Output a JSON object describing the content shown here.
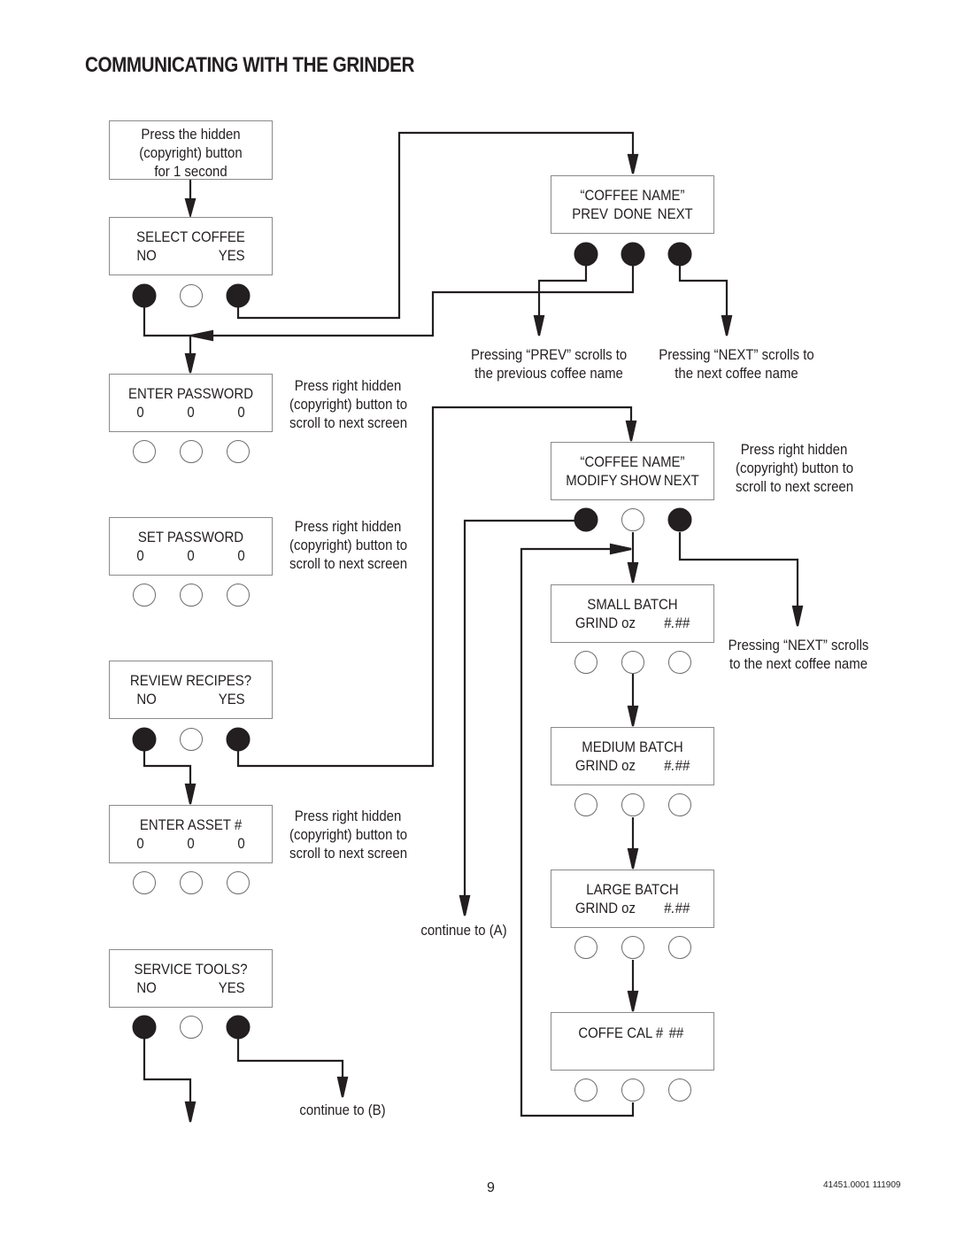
{
  "page": {
    "title": "COMMUNICATING WITH THE GRINDER",
    "page_number": "9",
    "doc_id": "41451.0001 111909"
  },
  "colors": {
    "line": "#231f20",
    "box_border": "#8a8a8a",
    "filled_button": "#231f20"
  },
  "start_box": {
    "lines": [
      "Press the hidden",
      "(copyright) button",
      "for 1 second"
    ]
  },
  "screens": {
    "select_coffee": {
      "line1": "SELECT COFFEE",
      "left": "NO",
      "right": "YES",
      "buttons": [
        "filled",
        "empty",
        "filled"
      ]
    },
    "enter_password": {
      "line1": "ENTER PASSWORD",
      "values": [
        "0",
        "0",
        "0"
      ],
      "buttons": [
        "empty",
        "empty",
        "empty"
      ]
    },
    "set_password": {
      "line1": "SET  PASSWORD",
      "values": [
        "0",
        "0",
        "0"
      ],
      "buttons": [
        "empty",
        "empty",
        "empty"
      ]
    },
    "review_recipes": {
      "line1": "REVIEW RECIPES?",
      "left": "NO",
      "right": "YES",
      "buttons": [
        "filled",
        "empty",
        "filled"
      ]
    },
    "enter_asset": {
      "line1": "ENTER ASSET  #",
      "values": [
        "0",
        "0",
        "0"
      ],
      "buttons": [
        "empty",
        "empty",
        "empty"
      ]
    },
    "service_tools": {
      "line1": "SERVICE TOOLS?",
      "left": "NO",
      "right": "YES",
      "buttons": [
        "filled",
        "empty",
        "filled"
      ]
    },
    "coffee_name_1": {
      "line1": "“COFFEE NAME”",
      "options": [
        "PREV",
        "DONE",
        "NEXT"
      ],
      "buttons": [
        "filled",
        "filled",
        "filled"
      ]
    },
    "coffee_name_2": {
      "line1": "“COFFEE NAME”",
      "options": [
        "MODIFY",
        "SHOW",
        "NEXT"
      ],
      "buttons": [
        "filled",
        "empty",
        "filled"
      ]
    },
    "small_batch": {
      "line1": "SMALL BATCH",
      "label": "GRIND oz",
      "value": "#.##",
      "buttons": [
        "empty",
        "empty",
        "empty"
      ]
    },
    "medium_batch": {
      "line1": "MEDIUM BATCH",
      "label": "GRIND oz",
      "value": "#.##",
      "buttons": [
        "empty",
        "empty",
        "empty"
      ]
    },
    "large_batch": {
      "line1": "LARGE BATCH",
      "label": "GRIND oz",
      "value": "#.##",
      "buttons": [
        "empty",
        "empty",
        "empty"
      ]
    },
    "coffee_cal": {
      "label": "COFFE CAL #",
      "value": "##",
      "buttons": [
        "empty",
        "empty",
        "empty"
      ]
    }
  },
  "notes": {
    "enter_password": [
      "Press right hidden",
      "(copyright) button to",
      "scroll to next screen"
    ],
    "set_password": [
      "Press right hidden",
      "(copyright) button to",
      "scroll to next screen"
    ],
    "enter_asset": [
      "Press right hidden",
      "(copyright) button to",
      "scroll to next screen"
    ],
    "coffee_name_2": [
      "Press right hidden",
      "(copyright) button to",
      "scroll to next screen"
    ],
    "prev": [
      "Pressing “PREV” scrolls to",
      "the previous coffee name"
    ],
    "next_top": [
      "Pressing “NEXT” scrolls to",
      "the next coffee name"
    ],
    "next_mid": [
      "Pressing “NEXT” scrolls",
      "to the next coffee name"
    ],
    "continue_a": "continue to (A)",
    "continue_b": "continue to (B)"
  }
}
